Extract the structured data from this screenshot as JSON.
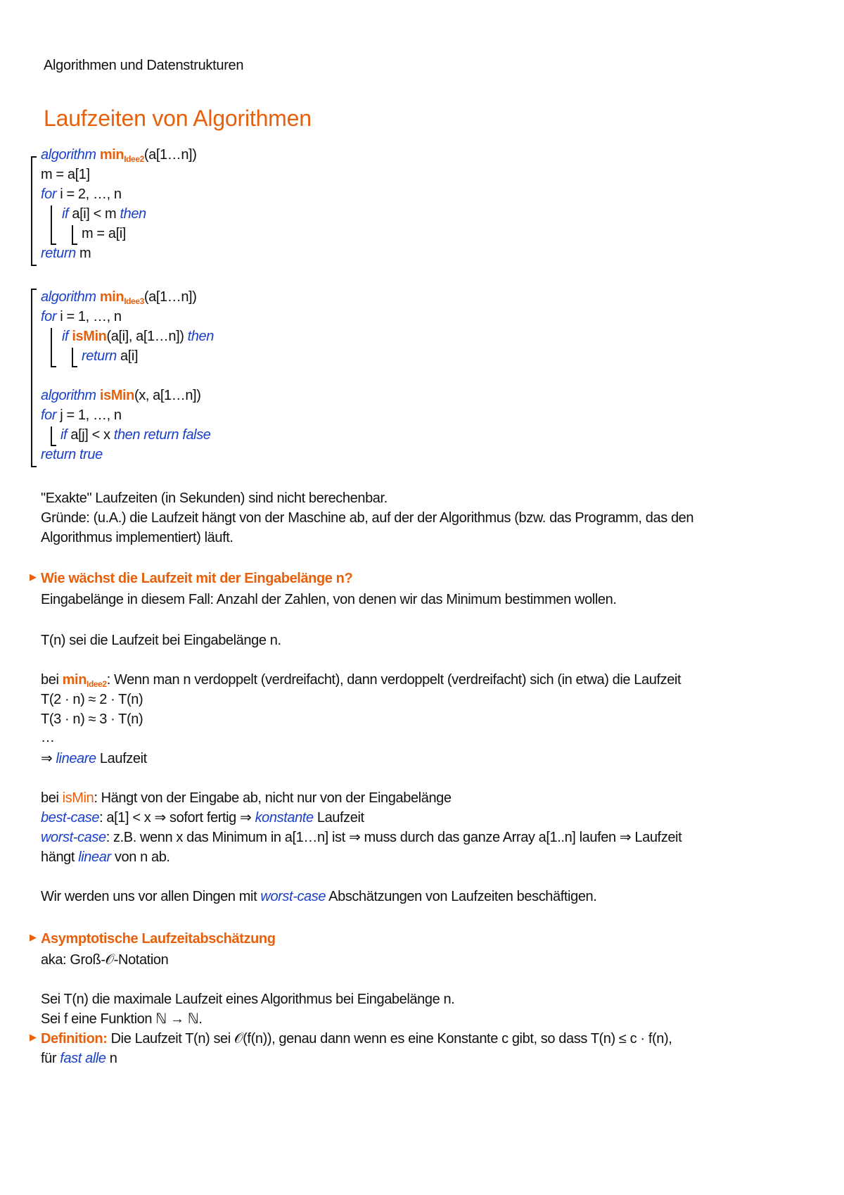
{
  "header": {
    "course": "Algorithmen und Datenstrukturen",
    "title": "Laufzeiten von Algorithmen"
  },
  "algo1": {
    "kw_algorithm": "algorithm",
    "name": "min",
    "name_sub": "Idee2",
    "params": "(a[1…n])",
    "line2": "m = a[1]",
    "kw_for": "for",
    "for_rest": " i = 2, …, n",
    "kw_if": "if",
    "if_cond": " a[i] < m ",
    "kw_then": "then",
    "assign": "m = a[i]",
    "kw_return": "return",
    "return_val": " m"
  },
  "algo2": {
    "kw_algorithm": "algorithm",
    "name": "min",
    "name_sub": "Idee3",
    "params": "(a[1…n])",
    "kw_for": "for",
    "for_rest": " i = 1, …, n",
    "kw_if": "if",
    "call_fn": "isMin",
    "call_args": "(a[i], a[1…n]) ",
    "kw_then": "then",
    "kw_return": "return",
    "return_val": " a[i]"
  },
  "algo3": {
    "kw_algorithm": "algorithm",
    "name": "isMin",
    "params": "(x, a[1…n])",
    "kw_for": "for",
    "for_rest": " j = 1, …, n",
    "kw_if": "if",
    "if_cond": " a[j] < x ",
    "then_return_false": "then return false",
    "return_true": "return true"
  },
  "para1": {
    "line1": "\"Exakte\" Laufzeiten (in Sekunden) sind nicht berechenbar.",
    "line2": "Gründe: (u.A.) die Laufzeit hängt von der Maschine ab, auf der der Algorithmus (bzw. das Programm, das den",
    "line3": "Algorithmus implementiert) läuft."
  },
  "section1": {
    "heading": "Wie wächst die Laufzeit mit der Eingabelänge n?",
    "line1": "Eingabelänge in diesem Fall: Anzahl der Zahlen, von denen wir das Minimum bestimmen wollen.",
    "line2": "T(n) sei die Laufzeit bei Eingabelänge n.",
    "bei": "bei ",
    "min_name": "min",
    "min_sub": "Idee2",
    "min_text": ": Wenn man n verdoppelt (verdreifacht), dann verdoppelt (verdreifacht) sich (in etwa) die Laufzeit",
    "eq1": "T(2 · n) ≈ 2 · T(n)",
    "eq2": "T(3 · n) ≈ 3 · T(n)",
    "dots": "…",
    "implies": "⇒ ",
    "lineare": "lineare",
    "laufzeit": " Laufzeit",
    "ismin_bei": "bei ",
    "ismin_name": "isMin",
    "ismin_text": ": Hängt von der Eingabe ab, nicht nur von der Eingabelänge",
    "best_case": "best-case",
    "best_text1": ": a[1] < x ⇒ sofort fertig ⇒ ",
    "konstante": "konstante",
    "best_text2": " Laufzeit",
    "worst_case": "worst-case",
    "worst_text": ": z.B. wenn x das Minimum in a[1…n] ist  ⇒ muss durch das ganze Array a[1..n] laufen ⇒ Laufzeit",
    "haengt": "hängt ",
    "linear": "linear",
    "von_n_ab": " von n ab.",
    "wir_text1": "Wir werden uns vor allen Dingen mit ",
    "wir_worst": "worst-case",
    "wir_text2": " Abschätzungen von Laufzeiten beschäftigen."
  },
  "section2": {
    "heading": "Asymptotische Laufzeitabschätzung",
    "aka": "aka: Groß-𝒪-Notation",
    "sei1": "Sei T(n) die maximale Laufzeit eines Algorithmus bei Eingabelänge n.",
    "sei2": "Sei f eine Funktion ℕ → ℕ.",
    "def_label": "Definition:",
    "def_text": " Die Laufzeit T(n) sei 𝒪(f(n)), genau dann wenn es eine Konstante c gibt, so dass T(n) ≤ c · f(n),",
    "fuer": "für ",
    "fast_alle": "fast alle",
    "n": " n"
  },
  "icons": {
    "bullet": "▶"
  }
}
